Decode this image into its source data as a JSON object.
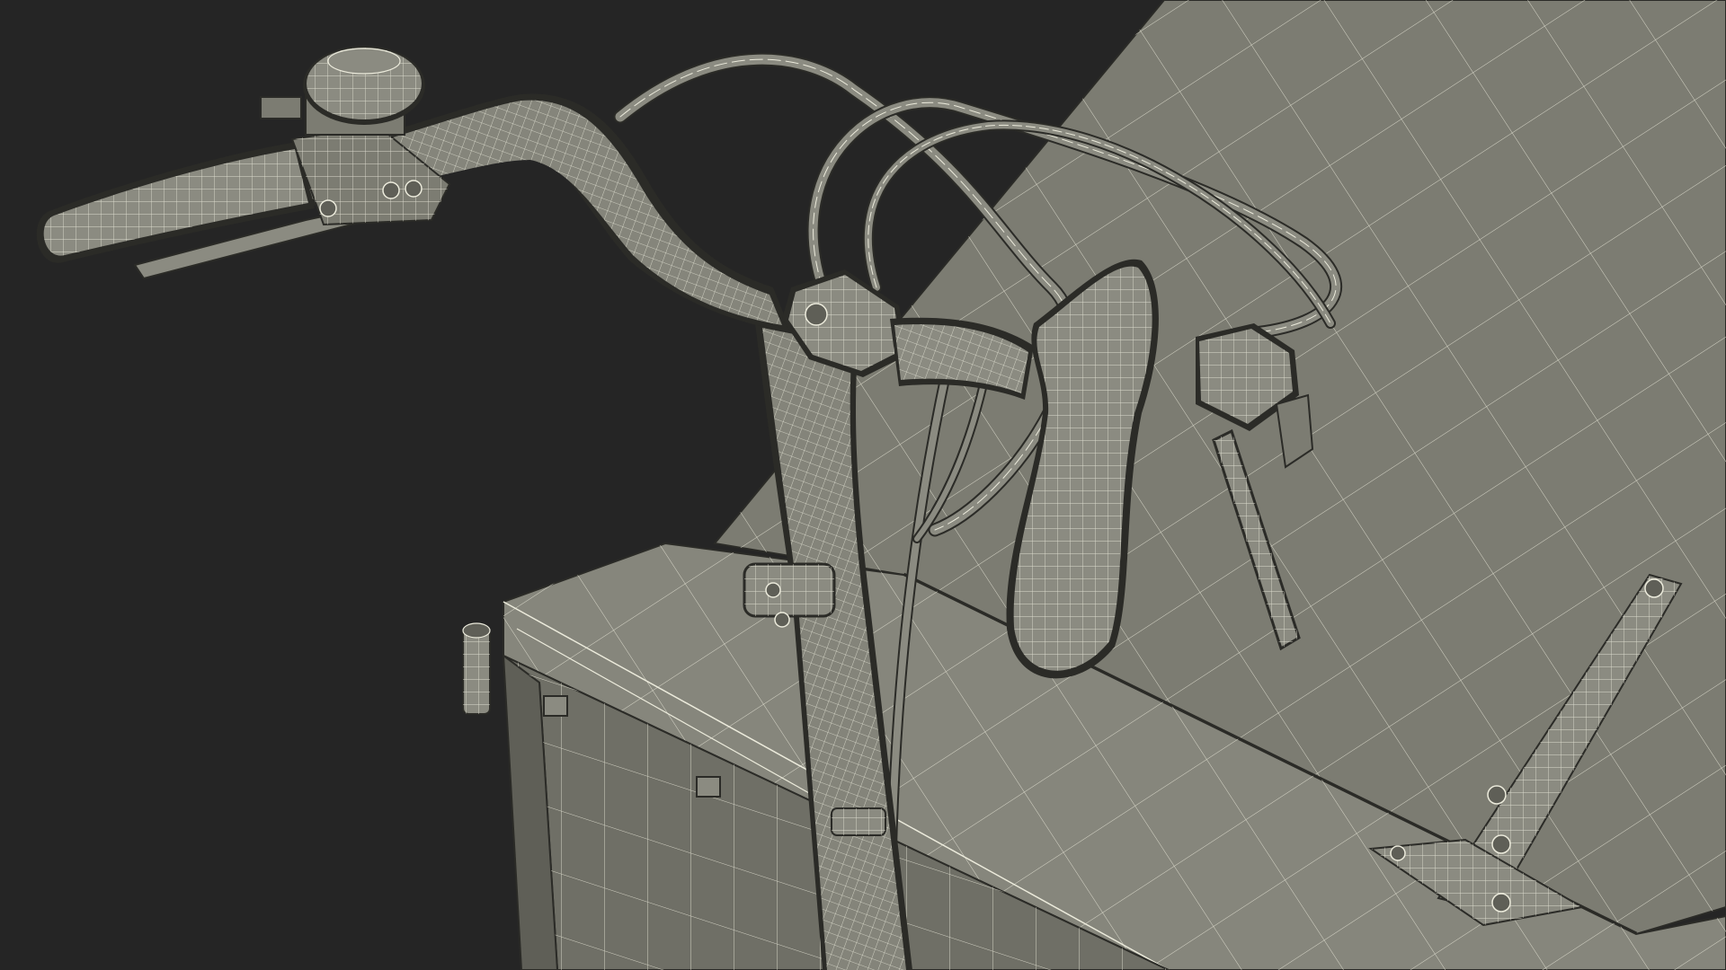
{
  "scene": {
    "subject": "cargo-bike-handlebar-wireframe",
    "colors": {
      "background": "#252525",
      "surface": "#7c7c72",
      "surface_light": "#8b8b81",
      "surface_dark": "#5f5f57",
      "wire": "#ecebdc",
      "edge": "#2b2b27"
    }
  }
}
